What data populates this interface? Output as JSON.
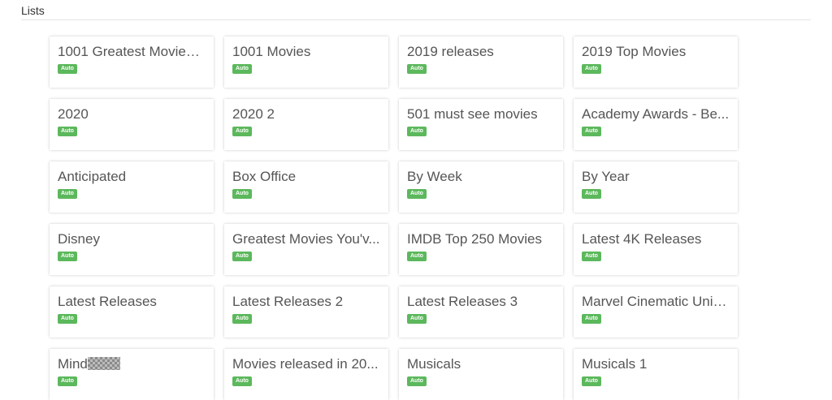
{
  "header": {
    "title": "Lists"
  },
  "lists": [
    {
      "name": "1001 Greatest Movies ...",
      "badge": "Auto"
    },
    {
      "name": "1001 Movies",
      "badge": "Auto"
    },
    {
      "name": "2019 releases",
      "badge": "Auto"
    },
    {
      "name": "2019 Top Movies",
      "badge": "Auto"
    },
    {
      "name": "2020",
      "badge": "Auto"
    },
    {
      "name": "2020 2",
      "badge": "Auto"
    },
    {
      "name": "501 must see movies",
      "badge": "Auto"
    },
    {
      "name": "Academy Awards - Be...",
      "badge": "Auto"
    },
    {
      "name": "Anticipated",
      "badge": "Auto"
    },
    {
      "name": "Box Office",
      "badge": "Auto"
    },
    {
      "name": "By Week",
      "badge": "Auto"
    },
    {
      "name": "By Year",
      "badge": "Auto"
    },
    {
      "name": "Disney",
      "badge": "Auto"
    },
    {
      "name": "Greatest Movies You'v...",
      "badge": "Auto"
    },
    {
      "name": "IMDB Top 250 Movies",
      "badge": "Auto"
    },
    {
      "name": "Latest 4K Releases",
      "badge": "Auto"
    },
    {
      "name": "Latest Releases",
      "badge": "Auto"
    },
    {
      "name": "Latest Releases 2",
      "badge": "Auto"
    },
    {
      "name": "Latest Releases 3",
      "badge": "Auto"
    },
    {
      "name": "Marvel Cinematic Univ...",
      "badge": "Auto"
    },
    {
      "name": "Mind",
      "badge": "Auto",
      "redacted": true
    },
    {
      "name": "Movies released in 20...",
      "badge": "Auto"
    },
    {
      "name": "Musicals",
      "badge": "Auto"
    },
    {
      "name": "Musicals 1",
      "badge": "Auto"
    }
  ],
  "colors": {
    "badge_bg": "#5cb85c",
    "title_text": "#555555",
    "header_rule": "#e6e6e6"
  }
}
